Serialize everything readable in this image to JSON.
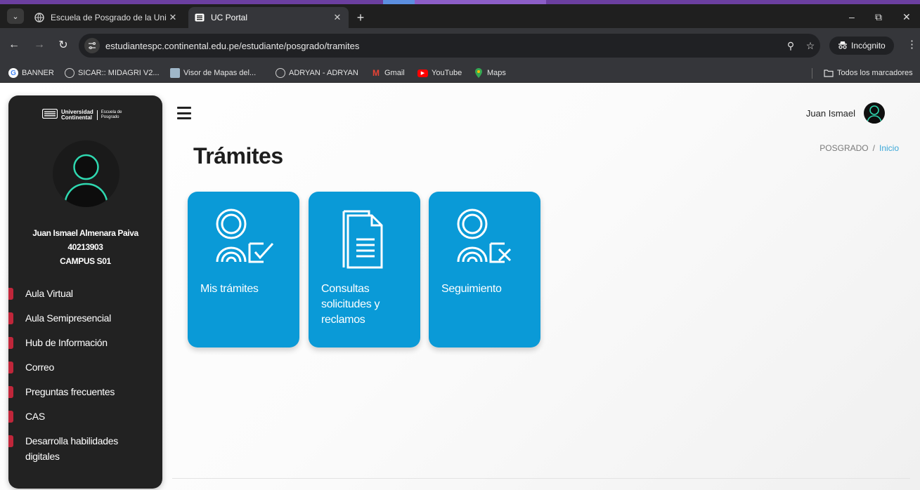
{
  "browser": {
    "tabs": [
      {
        "title": "Escuela de Posgrado de la Unive",
        "active": false
      },
      {
        "title": "UC Portal",
        "active": true
      }
    ],
    "url": "estudiantespc.continental.edu.pe/estudiante/posgrado/tramites",
    "incognito_label": "Incógnito",
    "bookmarks": [
      "BANNER",
      "SICAR:: MIDAGRI V2...",
      "Visor de Mapas del...",
      "ADRYAN - ADRYAN",
      "Gmail",
      "YouTube",
      "Maps"
    ],
    "all_bookmarks_label": "Todos los marcadores"
  },
  "sidebar": {
    "logo_main": "Universidad\nContinental",
    "logo_sub": "Escuela de\nPosgrado",
    "user_name": "Juan Ismael Almenara Paiva",
    "user_code": "40213903",
    "campus": "CAMPUS S01",
    "items": [
      {
        "label": "Aula Virtual"
      },
      {
        "label": "Aula Semipresencial"
      },
      {
        "label": "Hub de Información"
      },
      {
        "label": "Correo"
      },
      {
        "label": "Preguntas frecuentes"
      },
      {
        "label": "CAS"
      },
      {
        "label": "Desarrolla habilidades digitales"
      }
    ]
  },
  "header": {
    "user_short": "Juan Ismael"
  },
  "main": {
    "title": "Trámites",
    "breadcrumb_root": "POSGRADO",
    "breadcrumb_sep": "/",
    "breadcrumb_current": "Inicio",
    "cards": [
      {
        "label": "Mis trámites",
        "icon": "person-check-icon"
      },
      {
        "label": "Consultas solicitudes y reclamos",
        "icon": "document-icon"
      },
      {
        "label": "Seguimiento",
        "icon": "person-cross-icon"
      }
    ]
  },
  "colors": {
    "card_blue": "#0a9ad7",
    "sidebar_bg": "#222222",
    "nav_marker": "#c0263a",
    "breadcrumb_active": "#3aa7d8",
    "avatar_ring": "#2fd8b0"
  }
}
